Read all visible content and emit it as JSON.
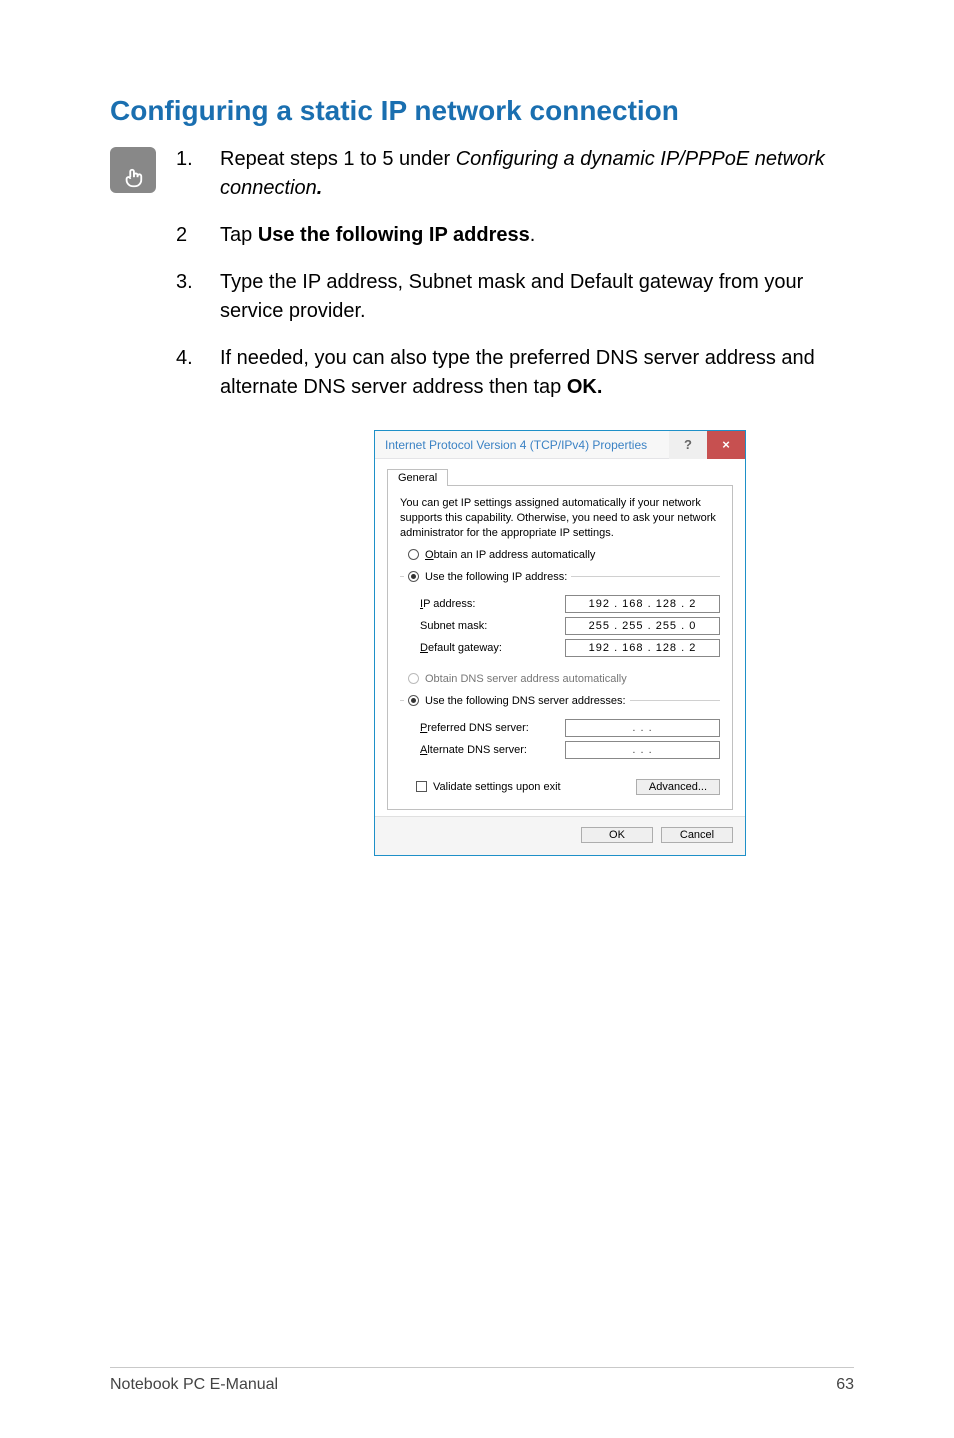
{
  "section_title": "Configuring a static IP network connection",
  "steps": [
    {
      "num": "1.",
      "pre": "Repeat steps 1 to 5 under ",
      "italic": "Configuring a dynamic IP/PPPoE network connection",
      "post_bold": "."
    },
    {
      "num": "2",
      "pre": "Tap ",
      "bold": "Use the following IP address",
      "post": "."
    },
    {
      "num": "3.",
      "plain": "Type the IP address, Subnet mask and Default gateway from your service provider."
    },
    {
      "num": "4.",
      "pre": "If needed, you can also type the preferred DNS server address and alternate DNS server address then tap ",
      "bold": "OK."
    }
  ],
  "dialog": {
    "title": "Internet Protocol Version 4 (TCP/IPv4) Properties",
    "help": "?",
    "close": "×",
    "tab": "General",
    "description": "You can get IP settings assigned automatically if your network supports this capability. Otherwise, you need to ask your network administrator for the appropriate IP settings.",
    "radio_obtain_ip": "Obtain an IP address automatically",
    "radio_use_ip": "Use the following IP address:",
    "ip_address_label": "IP address:",
    "ip_address_value": "192 . 168 . 128 .  2",
    "subnet_label": "Subnet mask:",
    "subnet_value": "255 . 255 . 255 .  0",
    "gateway_label": "Default gateway:",
    "gateway_value": "192 . 168 . 128 .  2",
    "radio_obtain_dns": "Obtain DNS server address automatically",
    "radio_use_dns": "Use the following DNS server addresses:",
    "pref_dns_label": "Preferred DNS server:",
    "pref_dns_value": ".        .        .",
    "alt_dns_label": "Alternate DNS server:",
    "alt_dns_value": ".        .        .",
    "validate_label": "Validate settings upon exit",
    "advanced_btn": "Advanced...",
    "ok_btn": "OK",
    "cancel_btn": "Cancel"
  },
  "footer": {
    "left": "Notebook PC E-Manual",
    "right": "63"
  }
}
